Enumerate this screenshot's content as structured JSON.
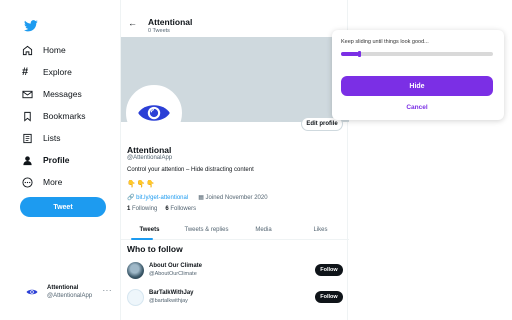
{
  "sidebar": {
    "items": [
      {
        "label": "Home",
        "icon": "home-icon"
      },
      {
        "label": "Explore",
        "icon": "hashtag-icon"
      },
      {
        "label": "Messages",
        "icon": "mail-icon"
      },
      {
        "label": "Bookmarks",
        "icon": "bookmark-icon"
      },
      {
        "label": "Lists",
        "icon": "list-icon"
      },
      {
        "label": "Profile",
        "icon": "person-icon"
      },
      {
        "label": "More",
        "icon": "more-circle-icon"
      }
    ],
    "tweet_button": "Tweet",
    "account": {
      "name": "Attentional",
      "handle": "@AttentionalApp",
      "more": "···"
    }
  },
  "header": {
    "back": "←",
    "title": "Attentional",
    "subtitle": "0 Tweets"
  },
  "profile": {
    "edit_button": "Edit profile",
    "name": "Attentional",
    "handle": "@AttentionalApp",
    "bio": "Control your attention – Hide distracting content",
    "emojis": "👇👇👇",
    "link": "bit.ly/get-attentional",
    "joined": "Joined November 2020",
    "following_count": "1",
    "following_label": "Following",
    "followers_count": "6",
    "followers_label": "Followers"
  },
  "tabs": [
    "Tweets",
    "Tweets & replies",
    "Media",
    "Likes"
  ],
  "who_to_follow": {
    "title": "Who to follow",
    "items": [
      {
        "name": "About Our Climate",
        "handle": "@AboutOurClimate",
        "button": "Follow"
      },
      {
        "name": "BarTalkWithJay",
        "handle": "@bartalkwithjay",
        "button": "Follow"
      }
    ]
  },
  "popup": {
    "instruction": "Keep sliding until things look good...",
    "slider_value": 0.12,
    "hide_button": "Hide",
    "cancel_button": "Cancel"
  },
  "colors": {
    "twitter_blue": "#1d9bf0",
    "accent_purple": "#7b2fe5"
  }
}
